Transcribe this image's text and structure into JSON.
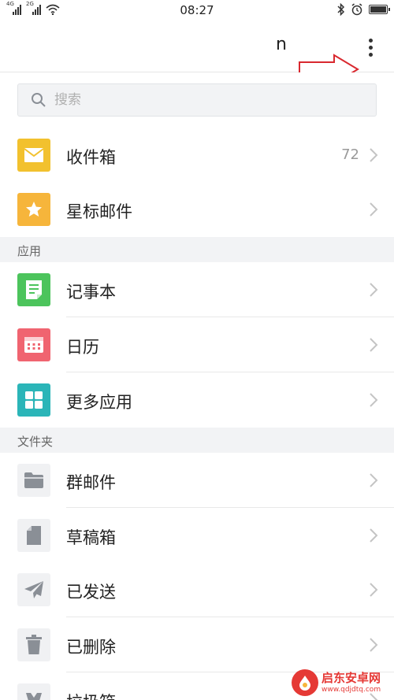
{
  "status_bar": {
    "time": "08:27",
    "signal_1_label": "4G",
    "signal_2_label": "2G",
    "icons": [
      "signal-icon",
      "wifi-icon",
      "bluetooth-icon",
      "alarm-icon",
      "battery-icon"
    ]
  },
  "header": {
    "title": "n",
    "more_icon": "more-vertical-icon"
  },
  "search": {
    "placeholder": "搜索",
    "icon": "search-icon"
  },
  "mailboxes": [
    {
      "label": "收件箱",
      "count": "72",
      "icon": "mail-icon",
      "color": "#f2c12e"
    },
    {
      "label": "星标邮件",
      "icon": "star-icon",
      "color": "#f6b53b"
    }
  ],
  "apps_section": {
    "header": "应用",
    "items": [
      {
        "label": "记事本",
        "icon": "notepad-icon",
        "color": "#4cc45c"
      },
      {
        "label": "日历",
        "icon": "calendar-icon",
        "color": "#f06470"
      },
      {
        "label": "更多应用",
        "icon": "apps-grid-icon",
        "color": "#2bb5b8"
      }
    ]
  },
  "folders_section": {
    "header": "文件夹",
    "items": [
      {
        "label": "群邮件",
        "icon": "folder-icon"
      },
      {
        "label": "草稿箱",
        "icon": "draft-icon"
      },
      {
        "label": "已发送",
        "icon": "send-icon"
      },
      {
        "label": "已删除",
        "icon": "trash-icon"
      },
      {
        "label": "垃圾箱",
        "icon": "spam-icon"
      }
    ]
  },
  "watermark": {
    "title": "启东安卓网",
    "url": "www.qdjdtq.com"
  },
  "colors": {
    "icon_gray_bg": "#f0f1f3",
    "icon_gray_fg": "#8a8f96",
    "annotation_arrow": "#d9282f"
  }
}
